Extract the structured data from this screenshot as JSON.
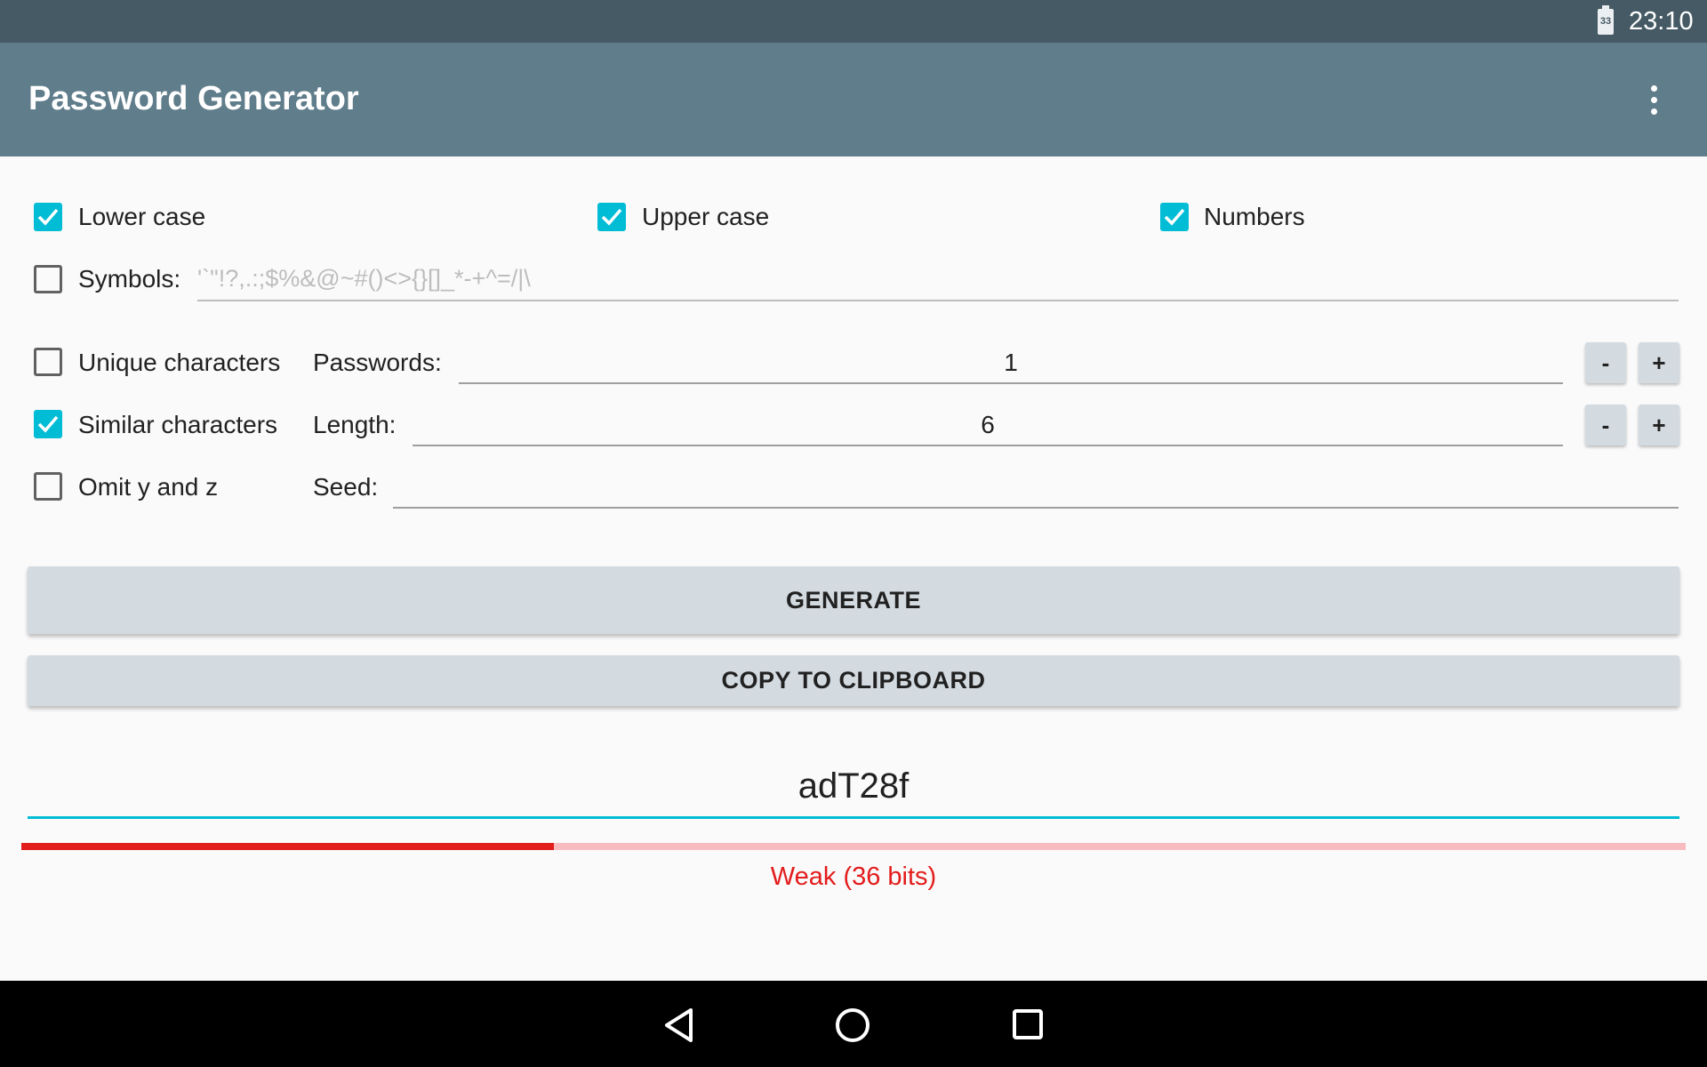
{
  "status_bar": {
    "time": "23:10",
    "battery_level": "33"
  },
  "app_bar": {
    "title": "Password Generator",
    "menu_icon": "more-vert-icon"
  },
  "options": {
    "lower_case": {
      "label": "Lower case",
      "checked": true
    },
    "upper_case": {
      "label": "Upper case",
      "checked": true
    },
    "numbers": {
      "label": "Numbers",
      "checked": true
    },
    "symbols": {
      "label": "Symbols:",
      "checked": false,
      "value": "'`\"!?,.:;$%&@~#()<>{}[]_*-+^=/|\\"
    },
    "unique_characters": {
      "label": "Unique characters",
      "checked": false
    },
    "similar_characters": {
      "label": "Similar characters",
      "checked": true
    },
    "omit_y_and_z": {
      "label": "Omit y and z",
      "checked": false
    }
  },
  "fields": {
    "passwords": {
      "label": "Passwords:",
      "value": "1",
      "minus": "-",
      "plus": "+"
    },
    "length": {
      "label": "Length:",
      "value": "6",
      "minus": "-",
      "plus": "+"
    },
    "seed": {
      "label": "Seed:",
      "value": ""
    }
  },
  "buttons": {
    "generate": "GENERATE",
    "copy": "COPY TO CLIPBOARD"
  },
  "output": {
    "password": "adT28f",
    "strength_label": "Weak (36 bits)",
    "strength_fraction": 0.32
  },
  "colors": {
    "accent": "#00bcd4",
    "app_bar": "#607d8b",
    "status_bar": "#455a64",
    "weak": "#e31c1c"
  },
  "nav_bar": {
    "back_icon": "back-triangle-icon",
    "home_icon": "home-circle-icon",
    "recents_icon": "recents-square-icon"
  }
}
